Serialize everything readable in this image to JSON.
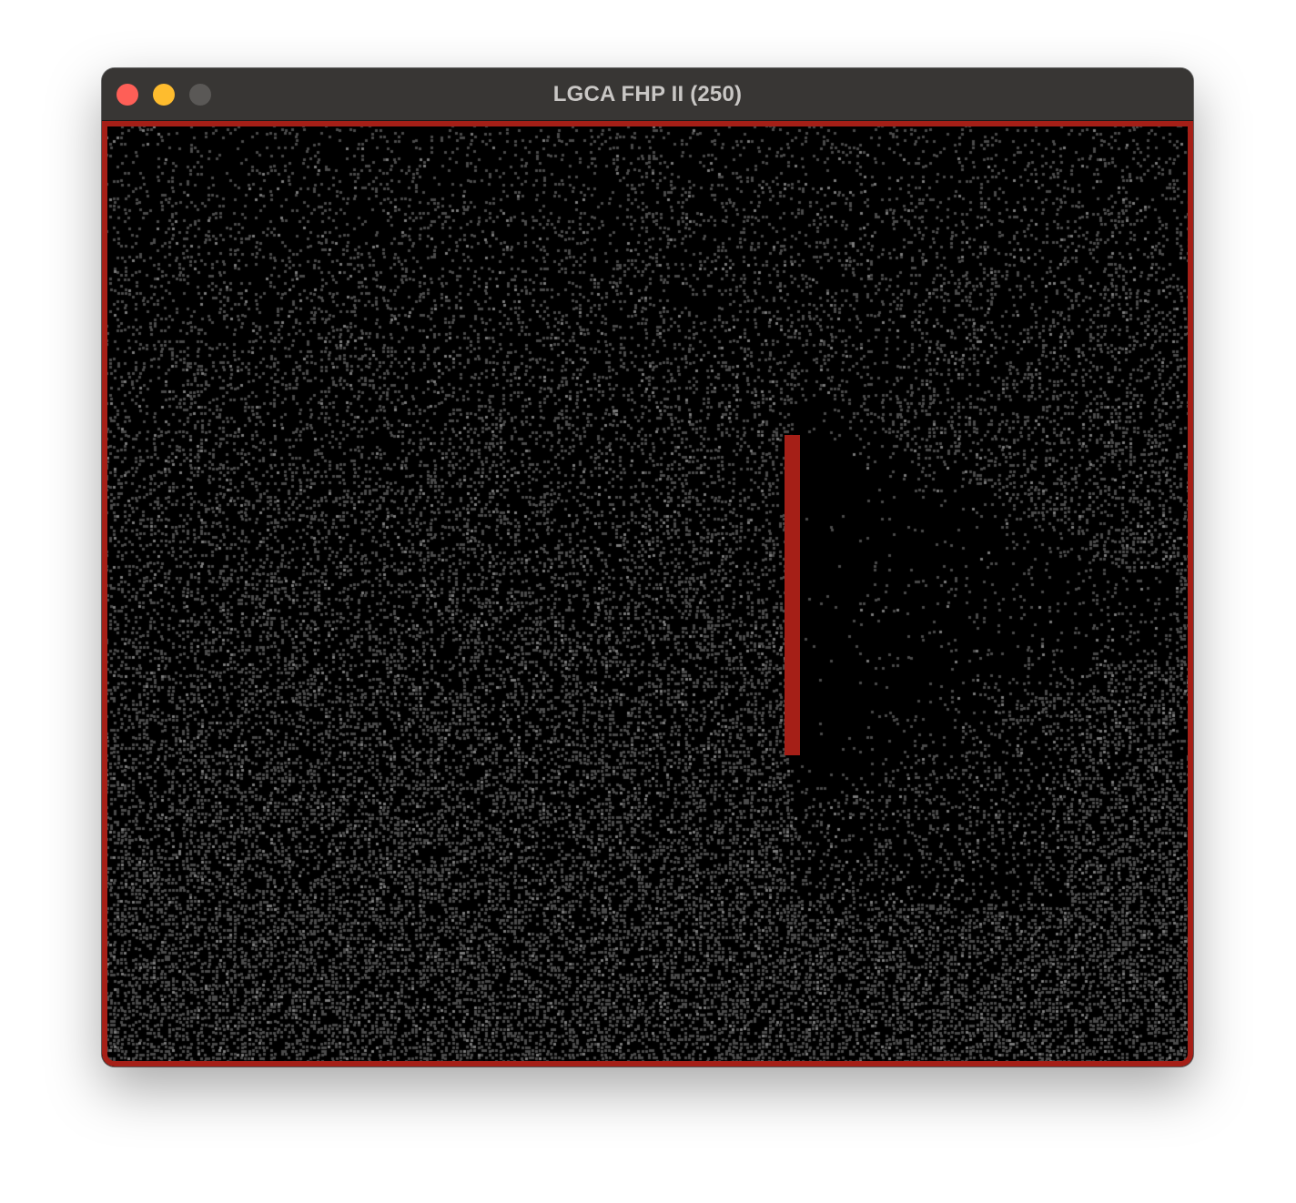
{
  "window": {
    "title": "LGCA FHP II (250)"
  },
  "colors": {
    "background": "#000000",
    "particle": "#4a4a4a",
    "particle_bright": "#7a7a7a",
    "boundary": "#a51f17",
    "titlebar": "#383634",
    "title_text": "#c9c7c5",
    "close": "#fe5f57",
    "minimize": "#febc2e",
    "zoom_inactive": "#5a5856"
  },
  "icons": {
    "close": "close-button-circle",
    "minimize": "minimize-button-circle",
    "zoom": "zoom-button-circle"
  }
}
